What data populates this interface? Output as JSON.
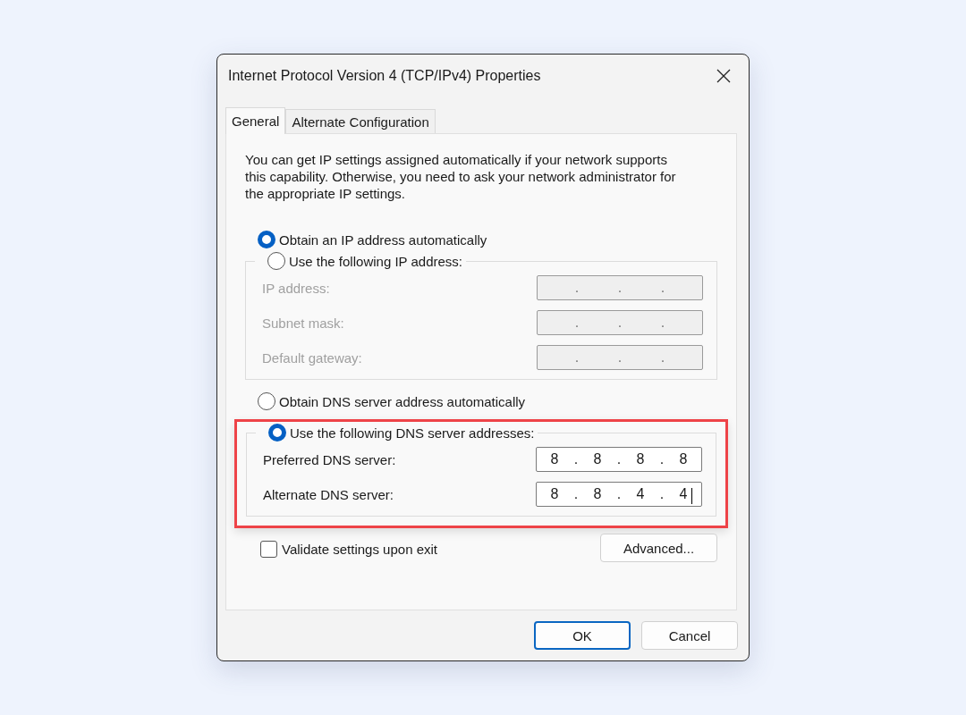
{
  "window": {
    "title": "Internet Protocol Version 4 (TCP/IPv4) Properties"
  },
  "tabs": [
    {
      "label": "General",
      "selected": true
    },
    {
      "label": "Alternate Configuration",
      "selected": false
    }
  ],
  "description": "You can get IP settings assigned automatically if your network supports this capability. Otherwise, you need to ask your network administrator for the appropriate IP settings.",
  "ip_section": {
    "highlighted": false,
    "auto_option": {
      "label": "Obtain an IP address automatically",
      "selected": true
    },
    "manual_option": {
      "label": "Use the following IP address:",
      "selected": false
    },
    "fields": [
      {
        "label": "IP address:",
        "disabled": true,
        "focused": false,
        "separators": [
          ".",
          ".",
          "."
        ]
      },
      {
        "label": "Subnet mask:",
        "disabled": true,
        "focused": false,
        "separators": [
          ".",
          ".",
          "."
        ]
      },
      {
        "label": "Default gateway:",
        "disabled": true,
        "focused": false,
        "separators": [
          ".",
          ".",
          "."
        ]
      }
    ]
  },
  "dns_section": {
    "highlighted": true,
    "auto_option": {
      "label": "Obtain DNS server address automatically",
      "selected": false
    },
    "manual_option": {
      "label": "Use the following DNS server addresses:",
      "selected": true
    },
    "fields": [
      {
        "label": "Preferred DNS server:",
        "disabled": false,
        "focused": false,
        "octets": [
          "8",
          "8",
          "8",
          "8"
        ],
        "separators": [
          ".",
          ".",
          "."
        ]
      },
      {
        "label": "Alternate DNS server:",
        "disabled": false,
        "focused": true,
        "octets": [
          "8",
          "8",
          "4",
          "4"
        ],
        "separators": [
          ".",
          ".",
          "."
        ]
      }
    ]
  },
  "validate": {
    "label": "Validate settings upon exit",
    "checked": false
  },
  "advanced_button": "Advanced...",
  "buttons": [
    {
      "label": "OK",
      "default": true
    },
    {
      "label": "Cancel",
      "default": false
    }
  ]
}
